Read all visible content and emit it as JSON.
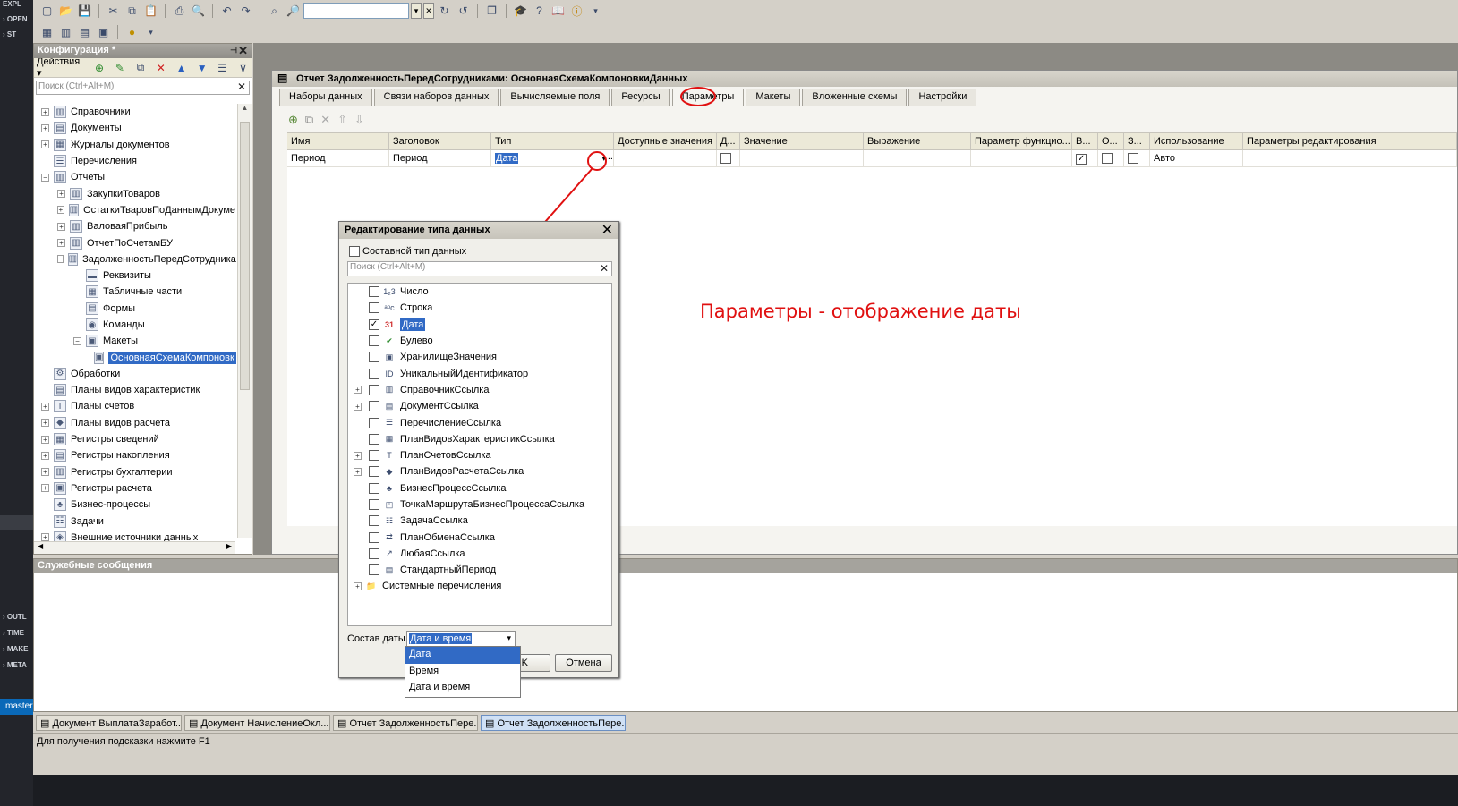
{
  "left_strip": {
    "items": [
      "EXPL",
      "OPEN",
      "ST",
      "OUTL",
      "TIME",
      "MAKE",
      "META"
    ],
    "branch": "master"
  },
  "toolbar": {
    "search_value": "",
    "icons": [
      "new-icon",
      "open-icon",
      "save-icon",
      "cut-icon",
      "copy-icon",
      "paste-icon",
      "print-icon",
      "print-preview-icon",
      "undo-icon",
      "redo-icon",
      "find-icon",
      "search-icon",
      "find-next-icon",
      "find-prev-icon",
      "windows-icon",
      "wizard-icon",
      "help-icon",
      "info-icon"
    ]
  },
  "config_panel": {
    "title": "Конфигурация *",
    "actions_label": "Действия",
    "search_placeholder": "Поиск (Ctrl+Alt+M)",
    "tree": [
      {
        "label": "Справочники",
        "indent": 0,
        "exp": "+",
        "icon": "catalog-icon"
      },
      {
        "label": "Документы",
        "indent": 0,
        "exp": "+",
        "icon": "document-icon"
      },
      {
        "label": "Журналы документов",
        "indent": 0,
        "exp": "+",
        "icon": "journal-icon"
      },
      {
        "label": "Перечисления",
        "indent": 0,
        "exp": "",
        "icon": "enum-icon"
      },
      {
        "label": "Отчеты",
        "indent": 0,
        "exp": "-",
        "icon": "report-icon"
      },
      {
        "label": "ЗакупкиТоваров",
        "indent": 1,
        "exp": "+",
        "icon": "report-icon"
      },
      {
        "label": "ОстаткиТваровПоДаннымДокуме",
        "indent": 1,
        "exp": "+",
        "icon": "report-icon"
      },
      {
        "label": "ВаловаяПрибыль",
        "indent": 1,
        "exp": "+",
        "icon": "report-icon"
      },
      {
        "label": "ОтчетПоСчетамБУ",
        "indent": 1,
        "exp": "+",
        "icon": "report-icon"
      },
      {
        "label": "ЗадолженностьПередСотрудника",
        "indent": 1,
        "exp": "-",
        "icon": "report-icon"
      },
      {
        "label": "Реквизиты",
        "indent": 2,
        "exp": "",
        "icon": "attribute-icon"
      },
      {
        "label": "Табличные части",
        "indent": 2,
        "exp": "",
        "icon": "table-icon"
      },
      {
        "label": "Формы",
        "indent": 2,
        "exp": "",
        "icon": "form-icon"
      },
      {
        "label": "Команды",
        "indent": 2,
        "exp": "",
        "icon": "command-icon"
      },
      {
        "label": "Макеты",
        "indent": 2,
        "exp": "-",
        "icon": "template-icon"
      },
      {
        "label": "ОсновнаяСхемаКомпоновк",
        "indent": 3,
        "exp": "",
        "icon": "template-icon",
        "selected": true
      },
      {
        "label": "Обработки",
        "indent": 0,
        "exp": "",
        "icon": "processing-icon"
      },
      {
        "label": "Планы видов характеристик",
        "indent": 0,
        "exp": "",
        "icon": "chart-of-characteristics-icon"
      },
      {
        "label": "Планы счетов",
        "indent": 0,
        "exp": "+",
        "icon": "chart-of-accounts-icon"
      },
      {
        "label": "Планы видов расчета",
        "indent": 0,
        "exp": "+",
        "icon": "calculation-types-icon"
      },
      {
        "label": "Регистры сведений",
        "indent": 0,
        "exp": "+",
        "icon": "info-register-icon"
      },
      {
        "label": "Регистры накопления",
        "indent": 0,
        "exp": "+",
        "icon": "accumulation-register-icon"
      },
      {
        "label": "Регистры бухгалтерии",
        "indent": 0,
        "exp": "+",
        "icon": "accounting-register-icon"
      },
      {
        "label": "Регистры расчета",
        "indent": 0,
        "exp": "+",
        "icon": "calculation-register-icon"
      },
      {
        "label": "Бизнес-процессы",
        "indent": 0,
        "exp": "",
        "icon": "business-process-icon"
      },
      {
        "label": "Задачи",
        "indent": 0,
        "exp": "",
        "icon": "task-icon"
      },
      {
        "label": "Внешние источники данных",
        "indent": 0,
        "exp": "+",
        "icon": "external-source-icon"
      }
    ]
  },
  "report_window": {
    "title": "Отчет ЗадолженностьПередСотрудниками: ОсновнаяСхемаКомпоновкиДанных",
    "tabs": [
      "Наборы данных",
      "Связи наборов данных",
      "Вычисляемые поля",
      "Ресурсы",
      "Параметры",
      "Макеты",
      "Вложенные схемы",
      "Настройки"
    ],
    "active_tab": "Параметры",
    "columns": [
      "Имя",
      "Заголовок",
      "Тип",
      "Доступные значения",
      "Д...",
      "Значение",
      "Выражение",
      "Параметр функцио...",
      "В...",
      "О...",
      "З...",
      "Использование",
      "Параметры редактирования"
    ],
    "row": {
      "name": "Период",
      "title": "Период",
      "type": "Дата",
      "usage": "Авто"
    }
  },
  "annotation": "Параметры - отображение даты",
  "messages_panel": {
    "title": "Служебные сообщения"
  },
  "dialog": {
    "title": "Редактирование типа данных",
    "composite_label": "Составной тип данных",
    "search_placeholder": "Поиск (Ctrl+Alt+M)",
    "types": [
      {
        "label": "Число",
        "exp": "",
        "checked": false,
        "icon": "number-icon",
        "glyph": "1₂3"
      },
      {
        "label": "Строка",
        "exp": "",
        "checked": false,
        "icon": "string-icon",
        "glyph": "ᵃᵇc"
      },
      {
        "label": "Дата",
        "exp": "",
        "checked": true,
        "icon": "date-icon",
        "glyph": "31",
        "selected": true
      },
      {
        "label": "Булево",
        "exp": "",
        "checked": false,
        "icon": "boolean-icon",
        "glyph": "✔"
      },
      {
        "label": "ХранилищеЗначения",
        "exp": "",
        "checked": false,
        "icon": "value-storage-icon",
        "glyph": "▣"
      },
      {
        "label": "УникальныйИдентификатор",
        "exp": "",
        "checked": false,
        "icon": "uuid-icon",
        "glyph": "ID"
      },
      {
        "label": "СправочникСсылка",
        "exp": "+",
        "checked": false,
        "icon": "catalog-ref-icon",
        "glyph": "▥"
      },
      {
        "label": "ДокументСсылка",
        "exp": "+",
        "checked": false,
        "icon": "document-ref-icon",
        "glyph": "▤"
      },
      {
        "label": "ПеречислениеСсылка",
        "exp": "",
        "checked": false,
        "icon": "enum-ref-icon",
        "glyph": "☰"
      },
      {
        "label": "ПланВидовХарактеристикСсылка",
        "exp": "",
        "checked": false,
        "icon": "characteristics-ref-icon",
        "glyph": "▦"
      },
      {
        "label": "ПланСчетовСсылка",
        "exp": "+",
        "checked": false,
        "icon": "accounts-ref-icon",
        "glyph": "Т"
      },
      {
        "label": "ПланВидовРасчетаСсылка",
        "exp": "+",
        "checked": false,
        "icon": "calculation-ref-icon",
        "glyph": "◆"
      },
      {
        "label": "БизнесПроцессСсылка",
        "exp": "",
        "checked": false,
        "icon": "business-process-ref-icon",
        "glyph": "♣"
      },
      {
        "label": "ТочкаМаршрутаБизнесПроцессаСсылка",
        "exp": "",
        "checked": false,
        "icon": "route-point-ref-icon",
        "glyph": "◳"
      },
      {
        "label": "ЗадачаСсылка",
        "exp": "",
        "checked": false,
        "icon": "task-ref-icon",
        "glyph": "☷"
      },
      {
        "label": "ПланОбменаСсылка",
        "exp": "",
        "checked": false,
        "icon": "exchange-ref-icon",
        "glyph": "⇄"
      },
      {
        "label": "ЛюбаяСсылка",
        "exp": "",
        "checked": false,
        "icon": "any-ref-icon",
        "glyph": "↗"
      },
      {
        "label": "СтандартныйПериод",
        "exp": "",
        "checked": false,
        "icon": "standard-period-icon",
        "glyph": "▤"
      },
      {
        "label": "Системные перечисления",
        "exp": "+",
        "checked": null,
        "icon": "folder-icon",
        "glyph": "📁"
      }
    ],
    "date_composition_label": "Состав даты",
    "date_composition_value": "Дата и время",
    "ok_label": "OK",
    "cancel_label": "Отмена",
    "dropdown_options": [
      "Дата",
      "Время",
      "Дата и время"
    ],
    "dropdown_highlighted": "Дата"
  },
  "window_tabs": [
    "Документ ВыплатаЗаработ...",
    "Документ НачислениеОкл...",
    "Отчет ЗадолженностьПере...",
    "Отчет ЗадолженностьПере..."
  ],
  "status_bar": "Для получения подсказки нажмите F1",
  "colors": {
    "selection": "#316ac5",
    "annotation": "#e01010",
    "panel": "#d4d0c8"
  }
}
